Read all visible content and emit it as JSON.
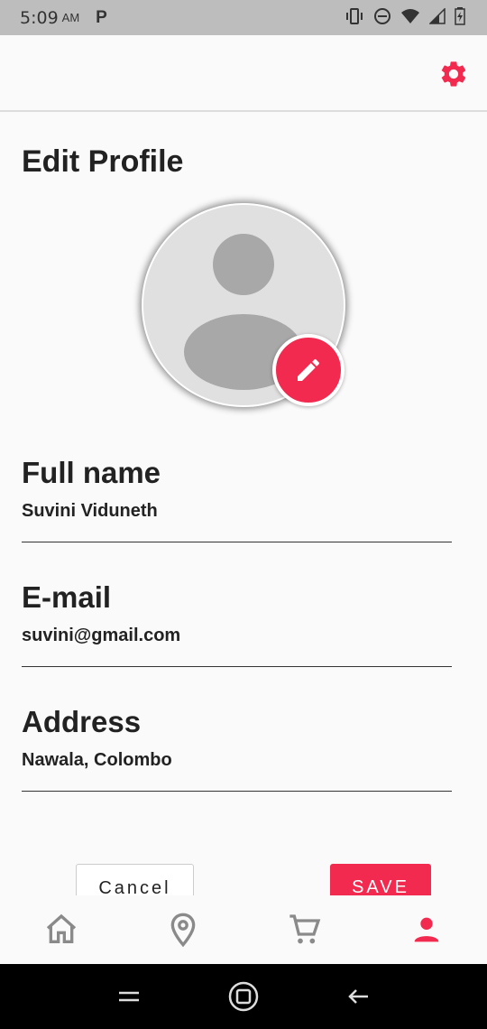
{
  "status_bar": {
    "time": "5:09",
    "ampm": "AM",
    "notification": "P"
  },
  "page": {
    "title": "Edit Profile"
  },
  "fields": [
    {
      "label": "Full name",
      "value": "Suvini Viduneth"
    },
    {
      "label": "E-mail",
      "value": "suvini@gmail.com"
    },
    {
      "label": "Address",
      "value": "Nawala, Colombo"
    }
  ],
  "buttons": {
    "cancel": "Cancel",
    "save": "SAVE"
  },
  "bottom_nav": {
    "items": [
      {
        "icon": "home-icon",
        "active": false
      },
      {
        "icon": "location-icon",
        "active": false
      },
      {
        "icon": "cart-icon",
        "active": false
      },
      {
        "icon": "person-icon",
        "active": true
      }
    ]
  },
  "colors": {
    "accent": "#f22a4f",
    "inactive_icon": "#8a8a8a"
  }
}
